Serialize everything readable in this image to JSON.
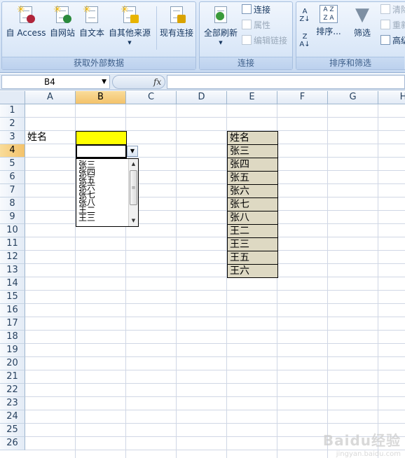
{
  "ribbon": {
    "get_external": {
      "label": "获取外部数据",
      "buttons": [
        "自 Access",
        "自网站",
        "自文本",
        "自其他来源",
        "现有连接"
      ]
    },
    "connections": {
      "label": "连接",
      "refresh_all": "全部刷新",
      "connections": "连接",
      "properties": "属性",
      "edit_links": "编辑链接"
    },
    "sort_filter": {
      "label": "排序和筛选",
      "sort": "排序...",
      "filter": "筛选",
      "clear": "清除",
      "reapply": "重新",
      "advanced": "高级"
    }
  },
  "formula_bar": {
    "name_box": "B4",
    "fx": "fx",
    "value": ""
  },
  "grid": {
    "columns": [
      "A",
      "B",
      "C",
      "D",
      "E",
      "F",
      "G",
      "H"
    ],
    "selected_column": "B",
    "rows": [
      "1",
      "2",
      "3",
      "4",
      "5",
      "6",
      "7",
      "8",
      "9",
      "10",
      "11",
      "12",
      "13",
      "14",
      "15",
      "16",
      "17",
      "18",
      "19",
      "20",
      "21",
      "22",
      "23",
      "24",
      "25",
      "26"
    ],
    "selected_row": "4",
    "cells": {
      "A3": "姓名",
      "E3": "姓名",
      "E4": "张三",
      "E5": "张四",
      "E6": "张五",
      "E7": "张六",
      "E8": "张七",
      "E9": "张八",
      "E10": "王二",
      "E11": "王三",
      "E12": "王五",
      "E13": "王六"
    },
    "highlight_color_b3": "#ffff00",
    "list_fill_color": "#ded9c3"
  },
  "dropdown": {
    "items": [
      "张三",
      "张四",
      "张五",
      "张六",
      "张七",
      "张八",
      "王二",
      "王三"
    ]
  },
  "watermark": {
    "text": "Baidu经验",
    "url": "jingyan.baidu.com"
  }
}
